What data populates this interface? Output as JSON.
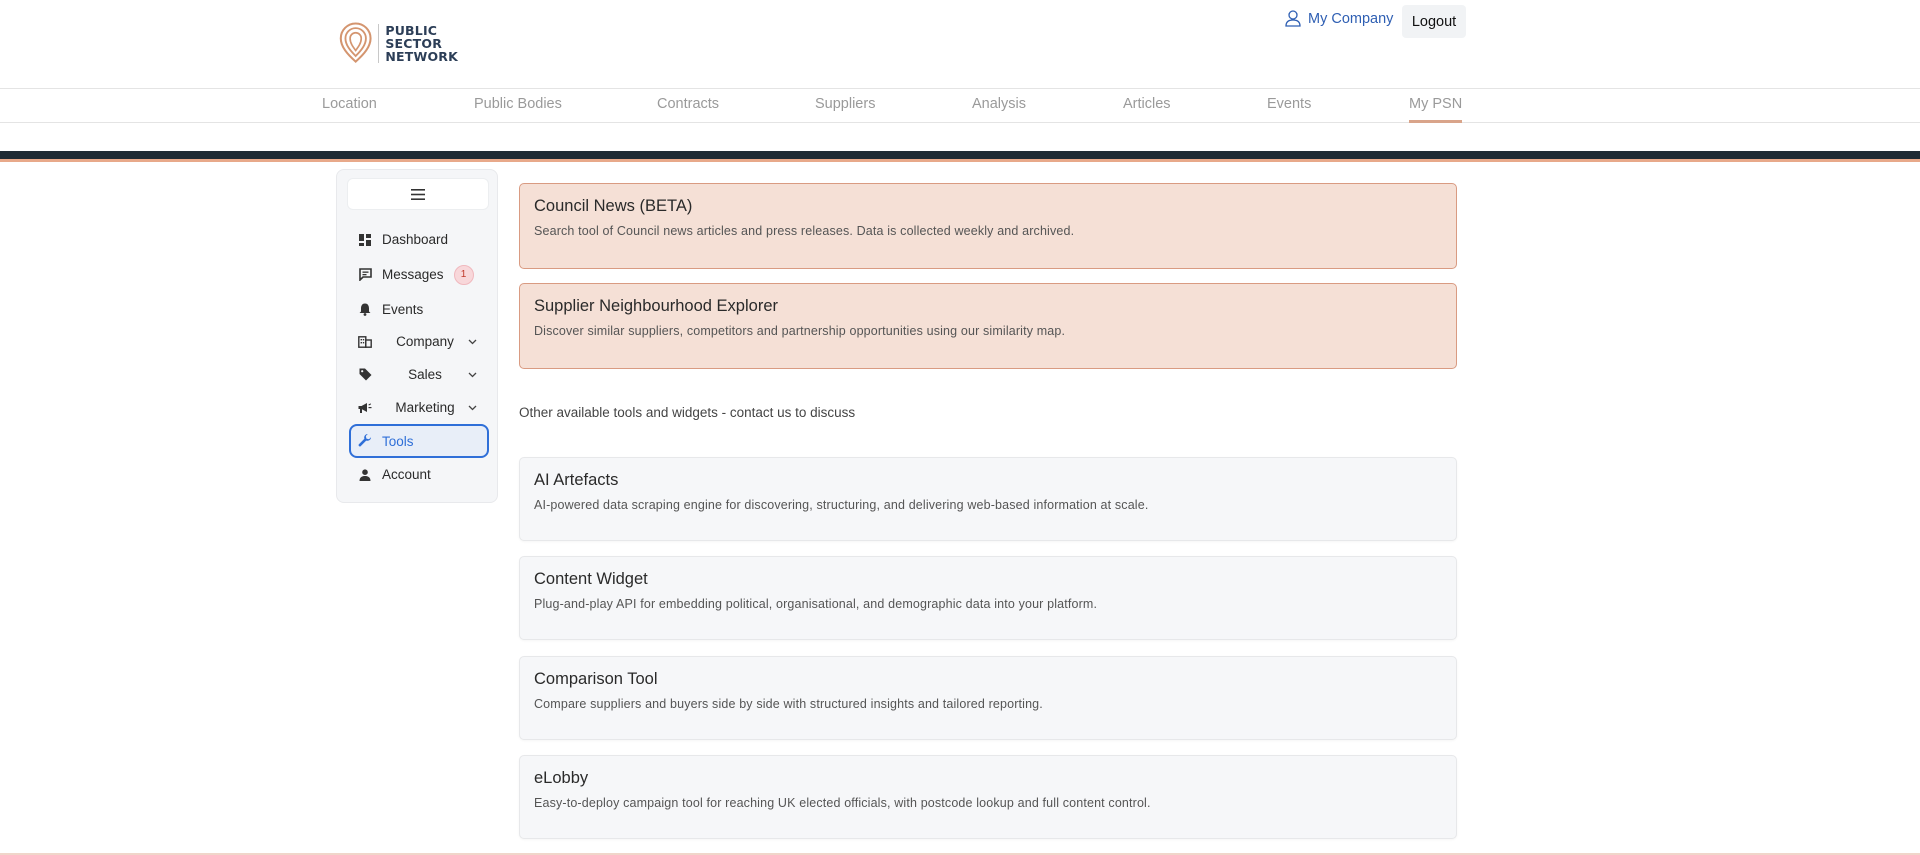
{
  "header": {
    "logo_lines": [
      "PUBLIC",
      "SECTOR",
      "NETWORK"
    ],
    "user_link_label": "My Company",
    "logout_label": "Logout"
  },
  "nav": {
    "items": [
      {
        "label": "Location"
      },
      {
        "label": "Public Bodies"
      },
      {
        "label": "Contracts"
      },
      {
        "label": "Suppliers"
      },
      {
        "label": "Analysis"
      },
      {
        "label": "Articles"
      },
      {
        "label": "Events"
      },
      {
        "label": "My PSN",
        "active": true
      }
    ]
  },
  "sidebar": {
    "items": [
      {
        "label": "Dashboard",
        "icon": "dashboard-icon"
      },
      {
        "label": "Messages",
        "icon": "message-icon",
        "badge": "1"
      },
      {
        "label": "Events",
        "icon": "bell-icon"
      },
      {
        "label": "Company",
        "icon": "building-icon",
        "expandable": true
      },
      {
        "label": "Sales",
        "icon": "tag-icon",
        "expandable": true
      },
      {
        "label": "Marketing",
        "icon": "megaphone-icon",
        "expandable": true
      },
      {
        "label": "Tools",
        "icon": "wrench-icon",
        "active": true
      },
      {
        "label": "Account",
        "icon": "person-icon"
      }
    ]
  },
  "featured_tools": [
    {
      "title": "Council News (BETA)",
      "description": "Search tool of Council news articles and press releases. Data is collected weekly and archived."
    },
    {
      "title": "Supplier Neighbourhood Explorer",
      "description": "Discover similar suppliers, competitors and partnership opportunities using our similarity map."
    }
  ],
  "other_tools_note": "Other available tools and widgets - contact us to discuss",
  "other_tools": [
    {
      "title": "AI Artefacts",
      "description": "AI-powered data scraping engine for discovering, structuring, and delivering web-based information at scale."
    },
    {
      "title": "Content Widget",
      "description": "Plug-and-play API for embedding political, organisational, and demographic data into your platform."
    },
    {
      "title": "Comparison Tool",
      "description": "Compare suppliers and buyers side by side with structured insights and tailored reporting."
    },
    {
      "title": "eLobby",
      "description": "Easy-to-deploy campaign tool for reaching UK elected officials, with postcode lookup and full content control."
    }
  ],
  "colors": {
    "accent": "#d9a48a",
    "link_blue": "#2f5fb3",
    "active_blue": "#2f6fd8",
    "band_dark": "#1e2a33",
    "featured_bg": "#f5e0d6"
  }
}
